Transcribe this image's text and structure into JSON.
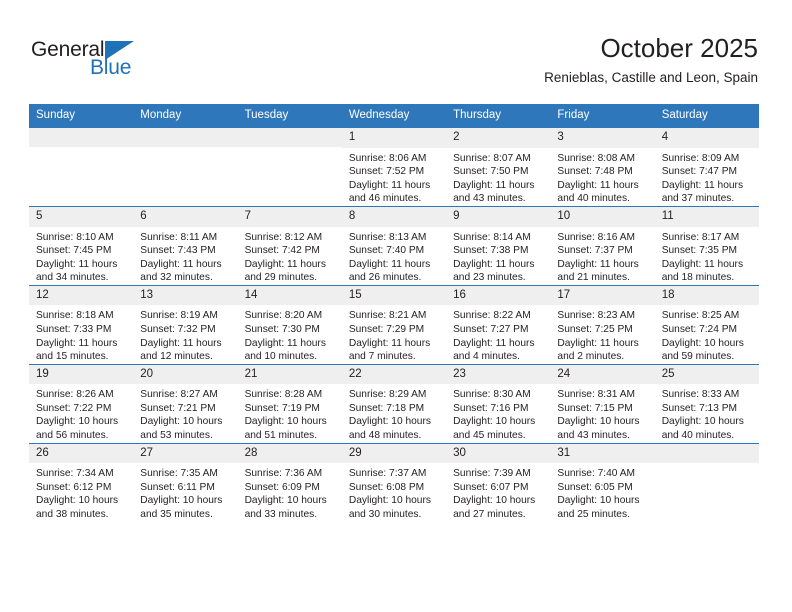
{
  "brand": {
    "name_top": "General",
    "name_bottom": "Blue",
    "triangle_color": "#1f72b8",
    "accent_color": "#2f77bb"
  },
  "header": {
    "title": "October 2025",
    "subtitle": "Renieblas, Castille and Leon, Spain"
  },
  "calendar": {
    "weekday_headers": [
      "Sunday",
      "Monday",
      "Tuesday",
      "Wednesday",
      "Thursday",
      "Friday",
      "Saturday"
    ],
    "weeks": [
      [
        {
          "day": "",
          "empty": true
        },
        {
          "day": "",
          "empty": true
        },
        {
          "day": "",
          "empty": true
        },
        {
          "day": "1",
          "sunrise": "Sunrise: 8:06 AM",
          "sunset": "Sunset: 7:52 PM",
          "daylight": "Daylight: 11 hours and 46 minutes."
        },
        {
          "day": "2",
          "sunrise": "Sunrise: 8:07 AM",
          "sunset": "Sunset: 7:50 PM",
          "daylight": "Daylight: 11 hours and 43 minutes."
        },
        {
          "day": "3",
          "sunrise": "Sunrise: 8:08 AM",
          "sunset": "Sunset: 7:48 PM",
          "daylight": "Daylight: 11 hours and 40 minutes."
        },
        {
          "day": "4",
          "sunrise": "Sunrise: 8:09 AM",
          "sunset": "Sunset: 7:47 PM",
          "daylight": "Daylight: 11 hours and 37 minutes."
        }
      ],
      [
        {
          "day": "5",
          "sunrise": "Sunrise: 8:10 AM",
          "sunset": "Sunset: 7:45 PM",
          "daylight": "Daylight: 11 hours and 34 minutes."
        },
        {
          "day": "6",
          "sunrise": "Sunrise: 8:11 AM",
          "sunset": "Sunset: 7:43 PM",
          "daylight": "Daylight: 11 hours and 32 minutes."
        },
        {
          "day": "7",
          "sunrise": "Sunrise: 8:12 AM",
          "sunset": "Sunset: 7:42 PM",
          "daylight": "Daylight: 11 hours and 29 minutes."
        },
        {
          "day": "8",
          "sunrise": "Sunrise: 8:13 AM",
          "sunset": "Sunset: 7:40 PM",
          "daylight": "Daylight: 11 hours and 26 minutes."
        },
        {
          "day": "9",
          "sunrise": "Sunrise: 8:14 AM",
          "sunset": "Sunset: 7:38 PM",
          "daylight": "Daylight: 11 hours and 23 minutes."
        },
        {
          "day": "10",
          "sunrise": "Sunrise: 8:16 AM",
          "sunset": "Sunset: 7:37 PM",
          "daylight": "Daylight: 11 hours and 21 minutes."
        },
        {
          "day": "11",
          "sunrise": "Sunrise: 8:17 AM",
          "sunset": "Sunset: 7:35 PM",
          "daylight": "Daylight: 11 hours and 18 minutes."
        }
      ],
      [
        {
          "day": "12",
          "sunrise": "Sunrise: 8:18 AM",
          "sunset": "Sunset: 7:33 PM",
          "daylight": "Daylight: 11 hours and 15 minutes."
        },
        {
          "day": "13",
          "sunrise": "Sunrise: 8:19 AM",
          "sunset": "Sunset: 7:32 PM",
          "daylight": "Daylight: 11 hours and 12 minutes."
        },
        {
          "day": "14",
          "sunrise": "Sunrise: 8:20 AM",
          "sunset": "Sunset: 7:30 PM",
          "daylight": "Daylight: 11 hours and 10 minutes."
        },
        {
          "day": "15",
          "sunrise": "Sunrise: 8:21 AM",
          "sunset": "Sunset: 7:29 PM",
          "daylight": "Daylight: 11 hours and 7 minutes."
        },
        {
          "day": "16",
          "sunrise": "Sunrise: 8:22 AM",
          "sunset": "Sunset: 7:27 PM",
          "daylight": "Daylight: 11 hours and 4 minutes."
        },
        {
          "day": "17",
          "sunrise": "Sunrise: 8:23 AM",
          "sunset": "Sunset: 7:25 PM",
          "daylight": "Daylight: 11 hours and 2 minutes."
        },
        {
          "day": "18",
          "sunrise": "Sunrise: 8:25 AM",
          "sunset": "Sunset: 7:24 PM",
          "daylight": "Daylight: 10 hours and 59 minutes."
        }
      ],
      [
        {
          "day": "19",
          "sunrise": "Sunrise: 8:26 AM",
          "sunset": "Sunset: 7:22 PM",
          "daylight": "Daylight: 10 hours and 56 minutes."
        },
        {
          "day": "20",
          "sunrise": "Sunrise: 8:27 AM",
          "sunset": "Sunset: 7:21 PM",
          "daylight": "Daylight: 10 hours and 53 minutes."
        },
        {
          "day": "21",
          "sunrise": "Sunrise: 8:28 AM",
          "sunset": "Sunset: 7:19 PM",
          "daylight": "Daylight: 10 hours and 51 minutes."
        },
        {
          "day": "22",
          "sunrise": "Sunrise: 8:29 AM",
          "sunset": "Sunset: 7:18 PM",
          "daylight": "Daylight: 10 hours and 48 minutes."
        },
        {
          "day": "23",
          "sunrise": "Sunrise: 8:30 AM",
          "sunset": "Sunset: 7:16 PM",
          "daylight": "Daylight: 10 hours and 45 minutes."
        },
        {
          "day": "24",
          "sunrise": "Sunrise: 8:31 AM",
          "sunset": "Sunset: 7:15 PM",
          "daylight": "Daylight: 10 hours and 43 minutes."
        },
        {
          "day": "25",
          "sunrise": "Sunrise: 8:33 AM",
          "sunset": "Sunset: 7:13 PM",
          "daylight": "Daylight: 10 hours and 40 minutes."
        }
      ],
      [
        {
          "day": "26",
          "sunrise": "Sunrise: 7:34 AM",
          "sunset": "Sunset: 6:12 PM",
          "daylight": "Daylight: 10 hours and 38 minutes."
        },
        {
          "day": "27",
          "sunrise": "Sunrise: 7:35 AM",
          "sunset": "Sunset: 6:11 PM",
          "daylight": "Daylight: 10 hours and 35 minutes."
        },
        {
          "day": "28",
          "sunrise": "Sunrise: 7:36 AM",
          "sunset": "Sunset: 6:09 PM",
          "daylight": "Daylight: 10 hours and 33 minutes."
        },
        {
          "day": "29",
          "sunrise": "Sunrise: 7:37 AM",
          "sunset": "Sunset: 6:08 PM",
          "daylight": "Daylight: 10 hours and 30 minutes."
        },
        {
          "day": "30",
          "sunrise": "Sunrise: 7:39 AM",
          "sunset": "Sunset: 6:07 PM",
          "daylight": "Daylight: 10 hours and 27 minutes."
        },
        {
          "day": "31",
          "sunrise": "Sunrise: 7:40 AM",
          "sunset": "Sunset: 6:05 PM",
          "daylight": "Daylight: 10 hours and 25 minutes."
        },
        {
          "day": "",
          "empty": true
        }
      ]
    ]
  }
}
